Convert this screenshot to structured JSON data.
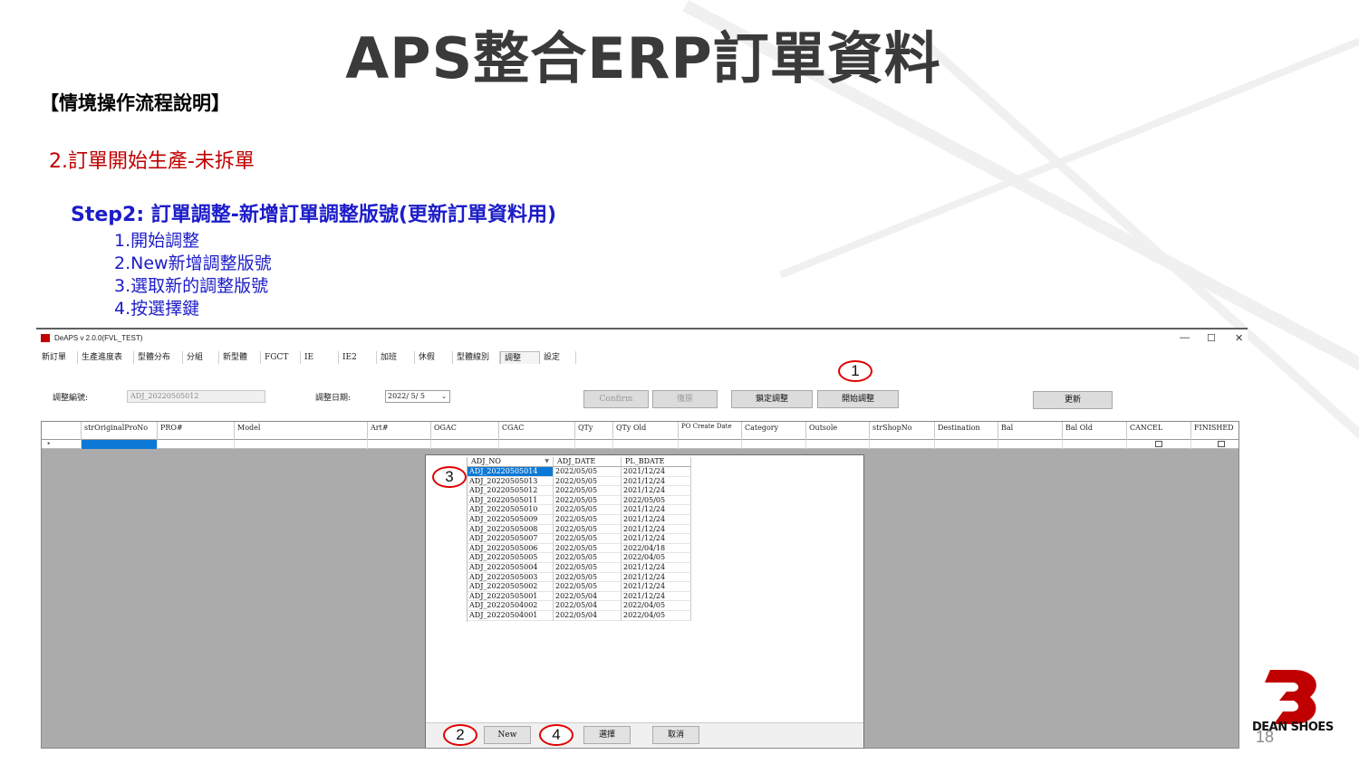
{
  "slide": {
    "title": "APS整合ERP訂單資料",
    "subtitle1": "【情境操作流程說明】",
    "subtitle2": "2.訂單開始生產-未拆單",
    "subtitle3": "Step2: 訂單調整-新增訂單調整版號(更新訂單資料用)",
    "steps": [
      "1.開始調整",
      "2.New新增調整版號",
      "3.選取新的調整版號",
      "4.按選擇鍵"
    ],
    "page_number": "18",
    "logo_text": "DEAN SHOES"
  },
  "app": {
    "window_title": "DeAPS v 2.0.0(FVL_TEST)",
    "window_controls": [
      "—",
      "☐",
      "✕"
    ],
    "tabs": [
      "新訂單",
      "生產進度表",
      "型體分布",
      "分組",
      "新型體",
      "FGCT",
      "IE",
      "IE2",
      "加班",
      "休假",
      "型體線別",
      "調整",
      "設定"
    ],
    "active_tab": "調整",
    "toolbar": {
      "adj_no_label": "調整編號:",
      "adj_no_value": "ADJ_20220505012",
      "adj_date_label": "調整日期:",
      "adj_date_value": "2022/ 5/ 5",
      "confirm_label": "Confirm",
      "restore_label": "復原",
      "lock_label": "鎖定調整",
      "start_label": "開始調整",
      "update_label": "更新"
    },
    "grid": {
      "columns": [
        "strOriginalProNo",
        "PRO#",
        "Model",
        "Art#",
        "OGAC",
        "CGAC",
        "QTy",
        "QTy Old",
        "PO Create Date",
        "Category",
        "Outsole",
        "strShopNo",
        "Destination",
        "Bal",
        "Bal Old",
        "CANCEL",
        "FINISHED"
      ],
      "new_row_marker": "*"
    },
    "popup": {
      "columns": [
        "ADJ_NO",
        "ADJ_DATE",
        "PL_BDATE"
      ],
      "rows": [
        [
          "ADJ_20220505014",
          "2022/05/05",
          "2021/12/24"
        ],
        [
          "ADJ_20220505013",
          "2022/05/05",
          "2021/12/24"
        ],
        [
          "ADJ_20220505012",
          "2022/05/05",
          "2021/12/24"
        ],
        [
          "ADJ_20220505011",
          "2022/05/05",
          "2022/05/05"
        ],
        [
          "ADJ_20220505010",
          "2022/05/05",
          "2021/12/24"
        ],
        [
          "ADJ_20220505009",
          "2022/05/05",
          "2021/12/24"
        ],
        [
          "ADJ_20220505008",
          "2022/05/05",
          "2021/12/24"
        ],
        [
          "ADJ_20220505007",
          "2022/05/05",
          "2021/12/24"
        ],
        [
          "ADJ_20220505006",
          "2022/05/05",
          "2022/04/18"
        ],
        [
          "ADJ_20220505005",
          "2022/05/05",
          "2022/04/05"
        ],
        [
          "ADJ_20220505004",
          "2022/05/05",
          "2021/12/24"
        ],
        [
          "ADJ_20220505003",
          "2022/05/05",
          "2021/12/24"
        ],
        [
          "ADJ_20220505002",
          "2022/05/05",
          "2021/12/24"
        ],
        [
          "ADJ_20220505001",
          "2022/05/04",
          "2021/12/24"
        ],
        [
          "ADJ_20220504002",
          "2022/05/04",
          "2022/04/05"
        ],
        [
          "ADJ_20220504001",
          "2022/05/04",
          "2022/04/05"
        ]
      ],
      "selected_row": 0,
      "new_label": "New",
      "select_label": "選擇",
      "cancel_label": "取消"
    },
    "markers": [
      "1",
      "2",
      "3",
      "4"
    ],
    "marker_color": "#e00000"
  }
}
